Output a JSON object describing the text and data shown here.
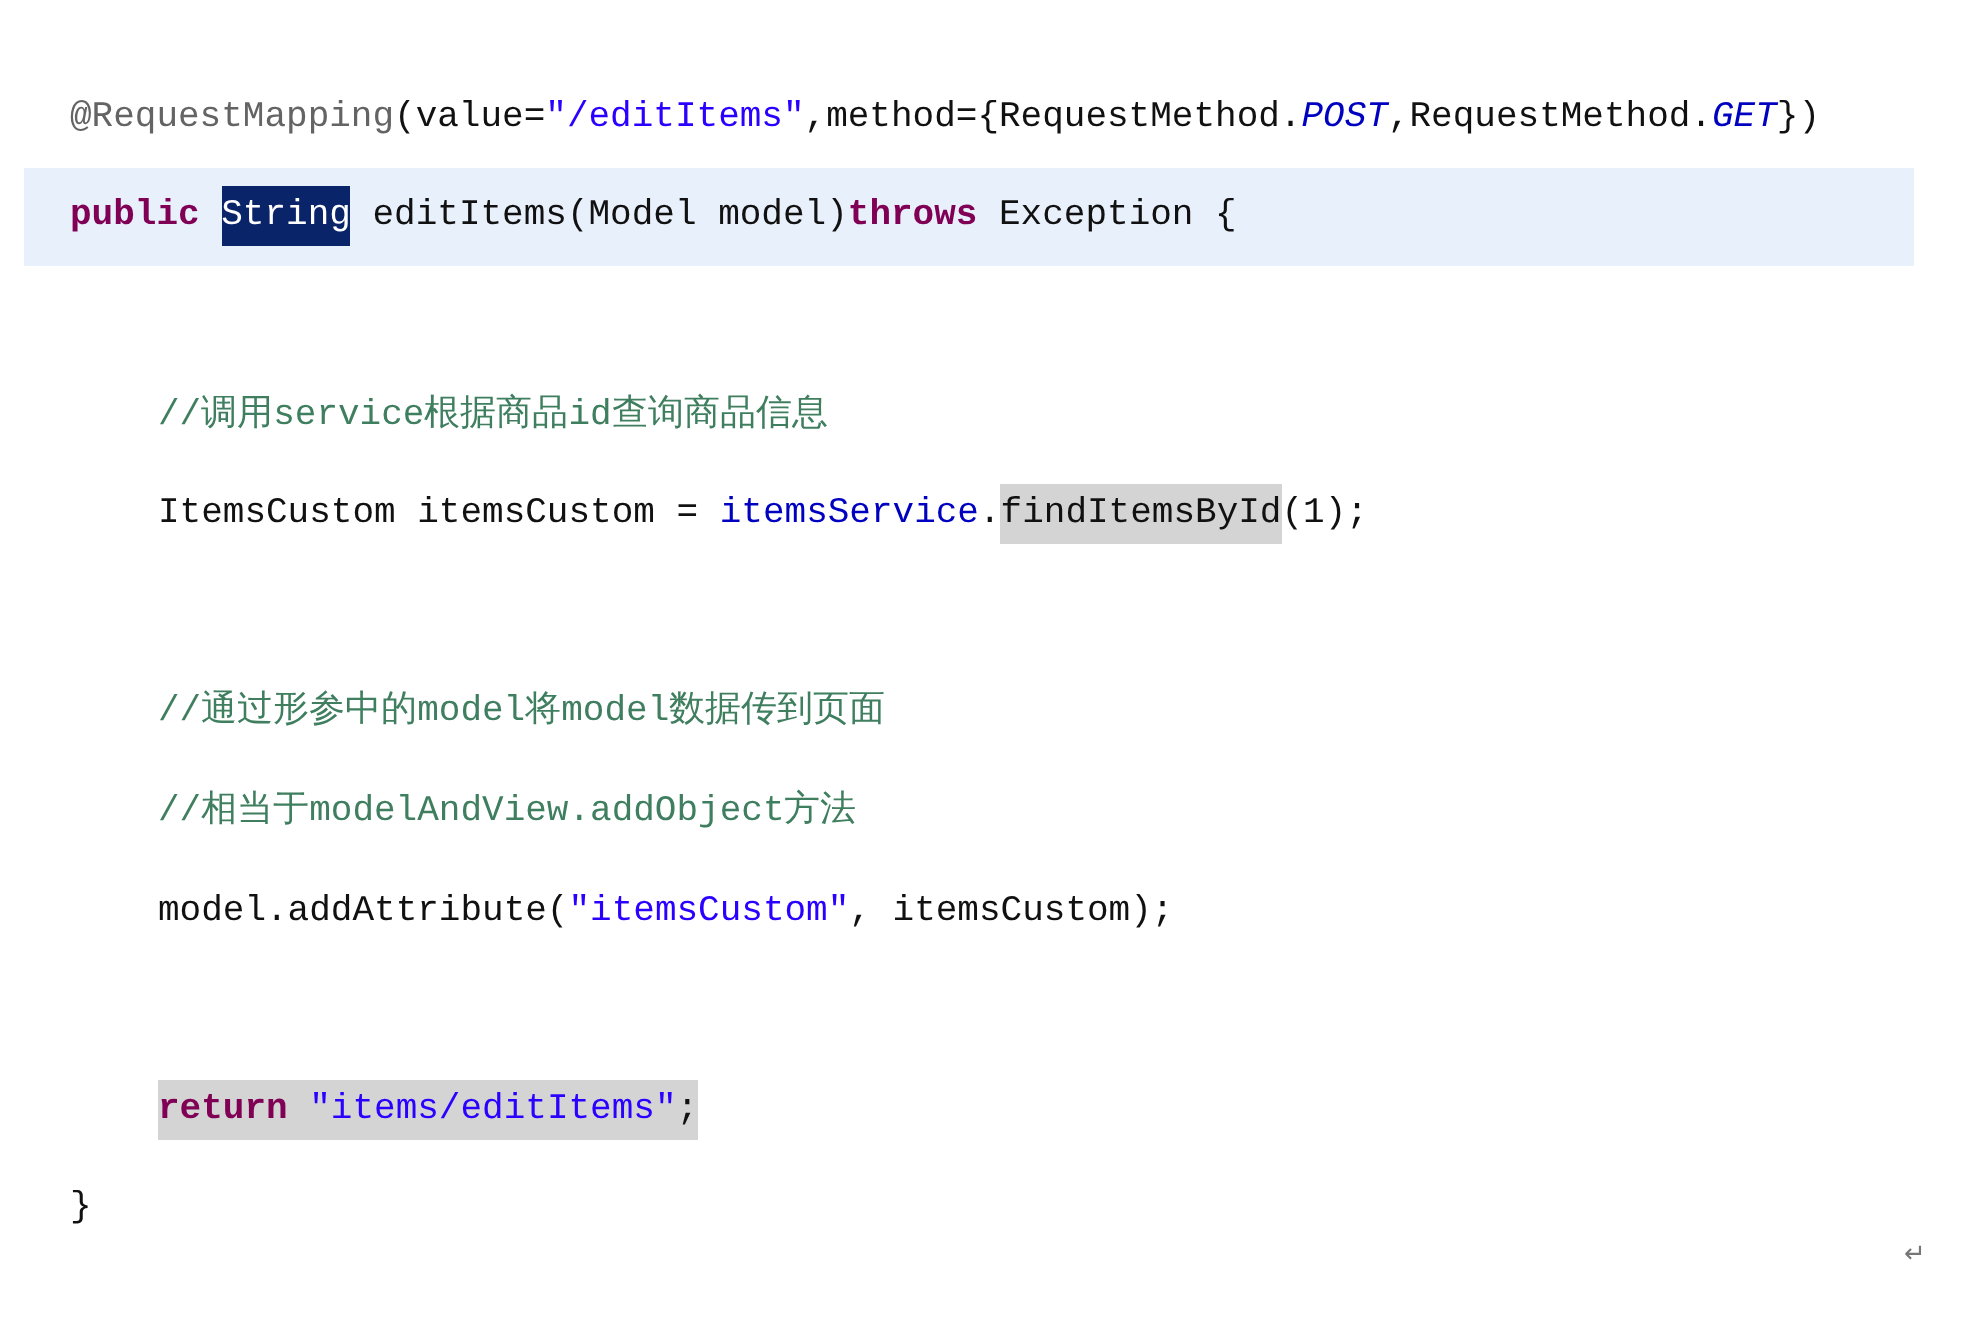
{
  "editor": {
    "lines": [
      {
        "kind": "code",
        "current": false,
        "tokens": [
          {
            "text": "@RequestMapping",
            "kind": "annotation"
          },
          {
            "text": "(value=",
            "kind": "plain"
          },
          {
            "text": "\"/editItems\"",
            "kind": "string"
          },
          {
            "text": ",method={RequestMethod.",
            "kind": "plain"
          },
          {
            "text": "POST",
            "kind": "constant"
          },
          {
            "text": ",RequestMethod.",
            "kind": "plain"
          },
          {
            "text": "GET",
            "kind": "constant"
          },
          {
            "text": "})",
            "kind": "plain"
          }
        ]
      },
      {
        "kind": "code",
        "current": true,
        "tokens": [
          {
            "text": "public ",
            "kind": "keyword"
          },
          {
            "text": "String",
            "kind": "selection"
          },
          {
            "text": " editItems(Model model)",
            "kind": "plain"
          },
          {
            "text": "throws",
            "kind": "keyword"
          },
          {
            "text": " Exception {",
            "kind": "plain"
          }
        ],
        "children": [
          {
            "kind": "blank"
          },
          {
            "kind": "code",
            "current": false,
            "tokens": [
              {
                "text": "//调用service根据商品id查询商品信息",
                "kind": "comment"
              }
            ]
          },
          {
            "kind": "code",
            "current": false,
            "tokens": [
              {
                "text": "ItemsCustom itemsCustom = ",
                "kind": "plain"
              },
              {
                "text": "itemsService",
                "kind": "field"
              },
              {
                "text": ".",
                "kind": "plain"
              },
              {
                "text": "findItemsById",
                "kind": "plain",
                "marked": true
              },
              {
                "text": "(1);",
                "kind": "plain"
              }
            ]
          },
          {
            "kind": "blank"
          },
          {
            "kind": "code",
            "current": false,
            "tokens": [
              {
                "text": "//通过形参中的model将model数据传到页面",
                "kind": "comment"
              }
            ]
          },
          {
            "kind": "code",
            "current": false,
            "tokens": [
              {
                "text": "//相当于modelAndView.addObject方法",
                "kind": "comment"
              }
            ]
          },
          {
            "kind": "code",
            "current": false,
            "tokens": [
              {
                "text": "model.addAttribute(",
                "kind": "plain"
              },
              {
                "text": "\"itemsCustom\"",
                "kind": "string"
              },
              {
                "text": ", itemsCustom);",
                "kind": "plain"
              }
            ]
          },
          {
            "kind": "blank"
          },
          {
            "kind": "code",
            "current": false,
            "tokens": [
              {
                "text": "return ",
                "kind": "keyword",
                "marked": true
              },
              {
                "text": "\"items/editItems\"",
                "kind": "string",
                "marked": true
              },
              {
                "text": ";",
                "kind": "plain",
                "marked": true
              }
            ]
          }
        ]
      },
      {
        "kind": "code",
        "current": false,
        "tokens": [
          {
            "text": "}",
            "kind": "plain"
          }
        ]
      }
    ],
    "paragraph_mark": "↵"
  }
}
